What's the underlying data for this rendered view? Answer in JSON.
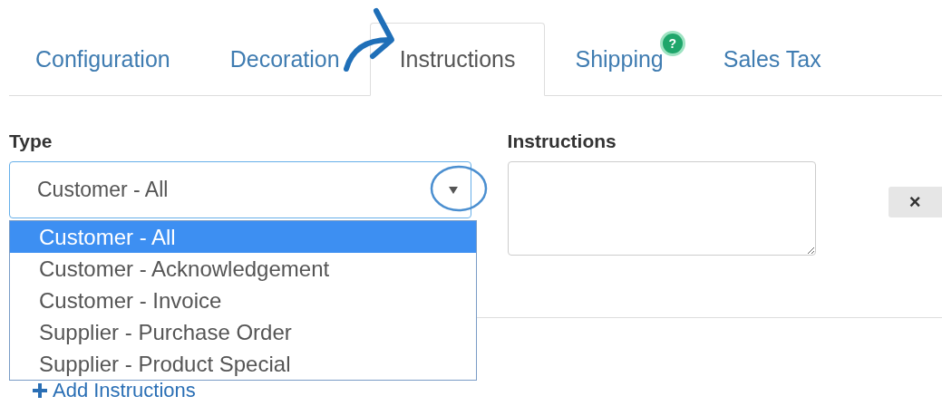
{
  "tabs": [
    {
      "label": "Configuration",
      "selected": false
    },
    {
      "label": "Decoration",
      "selected": false
    },
    {
      "label": "Instructions",
      "selected": true
    },
    {
      "label": "Shipping",
      "selected": false,
      "badge": "?"
    },
    {
      "label": "Sales Tax",
      "selected": false
    }
  ],
  "type_label": "Type",
  "type_select": {
    "value": "Customer - All",
    "open": true,
    "options": [
      {
        "label": "Customer - All",
        "selected": true
      },
      {
        "label": "Customer - Acknowledgement",
        "selected": false
      },
      {
        "label": "Customer - Invoice",
        "selected": false
      },
      {
        "label": "Supplier - Purchase Order",
        "selected": false
      },
      {
        "label": "Supplier - Product Special",
        "selected": false
      }
    ]
  },
  "instructions_label": "Instructions",
  "remove_button": "×",
  "add_link": "Add Instructions"
}
